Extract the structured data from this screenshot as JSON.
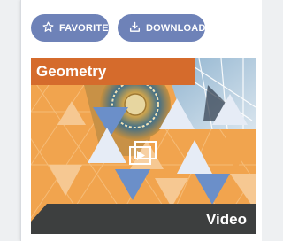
{
  "actions": {
    "favorite_label": "FAVORITE",
    "download_label": "DOWNLOAD"
  },
  "resource": {
    "title": "Geometry",
    "media_type": "Video"
  },
  "colors": {
    "button_bg": "#6e82b8",
    "title_bar": "#d56b2c",
    "tile_orange": "#f1a44e",
    "tile_blue": "#6b8fc9",
    "video_bar": "#3d3f3f"
  },
  "icons": {
    "favorite": "star-outline-icon",
    "download": "download-tray-icon",
    "play": "play-video-icon"
  }
}
